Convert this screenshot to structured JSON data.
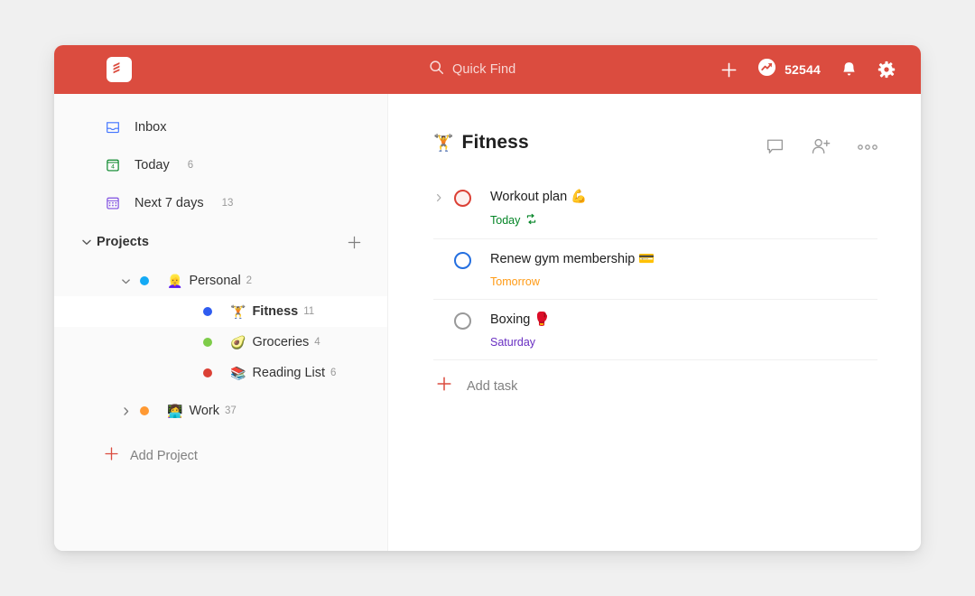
{
  "theme": {
    "header_bg": "#db4c3f",
    "sidebar_bg": "#fafafa",
    "accent_red": "#db4c3f",
    "text_primary": "#202020",
    "text_muted": "#808080"
  },
  "header": {
    "logo_name": "todoist-logo",
    "search": {
      "placeholder": "Quick Find",
      "value": ""
    },
    "add_label": "+",
    "karma": {
      "count": "52544",
      "icon": "karma-trending-icon"
    },
    "notifications_icon": "bell-icon",
    "settings_icon": "gear-icon"
  },
  "sidebar": {
    "nav": [
      {
        "label": "Inbox",
        "count": "",
        "icon": "inbox-icon",
        "color": "#4073ff"
      },
      {
        "label": "Today",
        "count": "6",
        "icon": "today-calendar-icon",
        "color": "#058527"
      },
      {
        "label": "Next 7 days",
        "count": "13",
        "icon": "week-calendar-icon",
        "color": "#7d4ce0"
      }
    ],
    "projects_section": {
      "title": "Projects",
      "caret": "chevron-down-icon",
      "add_icon": "plus-icon"
    },
    "projects": [
      {
        "name": "Personal",
        "count": "2",
        "emoji": "👱‍♀️",
        "dot": "#14aaf5",
        "caret": "down",
        "level": 1,
        "selected": false
      },
      {
        "name": "Fitness",
        "count": "11",
        "emoji": "🏋️",
        "dot": "#2f5cf0",
        "caret": "none",
        "level": 2,
        "selected": true
      },
      {
        "name": "Groceries",
        "count": "4",
        "emoji": "🥑",
        "dot": "#7ecc49",
        "dot2": "#6accbc",
        "caret": "none",
        "level": 2,
        "selected": false
      },
      {
        "name": "Reading List",
        "count": "6",
        "emoji": "📚",
        "dot": "#db4035",
        "caret": "none",
        "level": 2,
        "selected": false
      },
      {
        "name": "Work",
        "count": "37",
        "emoji": "👩‍💻",
        "dot": "#ff9933",
        "caret": "right",
        "level": 1,
        "selected": false
      }
    ],
    "add_project": {
      "label": "Add Project",
      "icon": "plus-icon"
    }
  },
  "content": {
    "title": "Fitness",
    "title_emoji": "🏋️",
    "actions": [
      {
        "name": "comments-icon"
      },
      {
        "name": "add-person-icon"
      },
      {
        "name": "more-options-icon"
      }
    ],
    "tasks": [
      {
        "text": "Workout plan 💪",
        "due": "Today",
        "due_color": "#058527",
        "recurring": true,
        "priority_color": "#db4035",
        "priority_fill": "#fdf0ef",
        "has_caret": true
      },
      {
        "text": "Renew gym membership 💳",
        "due": "Tomorrow",
        "due_color": "#ff9a14",
        "recurring": false,
        "priority_color": "#246fe0",
        "priority_fill": "transparent",
        "has_caret": false
      },
      {
        "text": "Boxing 🥊",
        "due": "Saturday",
        "due_color": "#692fc2",
        "recurring": false,
        "priority_color": "#808080",
        "priority_fill": "transparent",
        "has_caret": false
      }
    ],
    "add_task": {
      "label": "Add task",
      "icon": "plus-icon"
    }
  }
}
